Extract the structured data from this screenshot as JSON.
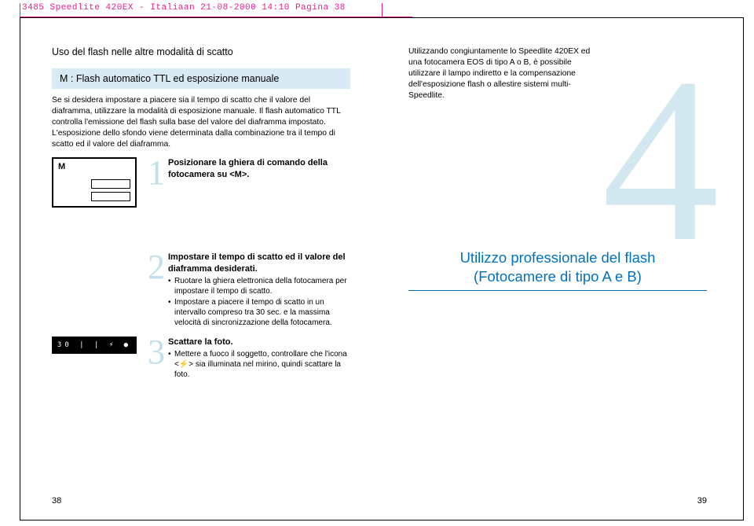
{
  "crop_header": "3485 Speedlite 420EX - Italiaan  21-08-2000  14:10  Pagina 38",
  "left": {
    "section_title": "Uso del flash nelle altre modalità di scatto",
    "mode_box": "M : Flash automatico TTL ed esposizione manuale",
    "intro": "Se si desidera impostare a piacere sia il tempo di scatto che il valore del diaframma, utilizzare la modalità di esposizione manuale. Il flash automatico TTL controlla l'emissione del flash sulla base del valore del diaframma impostato. L'esposizione dello sfondo viene determinata dalla combinazione tra il tempo di scatto ed il valore del diaframma.",
    "steps": [
      {
        "num": "1",
        "heading": "Posizionare la ghiera di comando della fotocamera su <M>."
      },
      {
        "num": "2",
        "heading": "Impostare il tempo di scatto ed il valore del diaframma desiderati.",
        "bullets": [
          "Ruotare la ghiera elettronica della fotocamera per impostare il tempo di scatto.",
          "Impostare a piacere il tempo di scatto in un intervallo compreso tra 30 sec. e la massima velocità di sincronizzazione della fotocamera."
        ]
      },
      {
        "num": "3",
        "heading": "Scattare la foto.",
        "bullets": [
          "Mettere a fuoco il soggetto, controllare che l'icona <⚡> sia illuminata nel mirino, quindi scattare la foto."
        ]
      }
    ],
    "display_m": "M",
    "display_readout": "30  | |  ⚡ ●",
    "page_num": "38"
  },
  "right": {
    "intro": "Utilizzando congiuntamente lo Speedlite 420EX ed una fotocamera EOS di tipo A o B, è possibile utilizzare il lampo indiretto e la compensazione dell'esposizione flash o allestire sistemi multi-Speedlite.",
    "big_num": "4",
    "heading_line1": "Utilizzo professionale del flash",
    "heading_line2": "(Fotocamere di tipo A e B)",
    "page_num": "39"
  }
}
